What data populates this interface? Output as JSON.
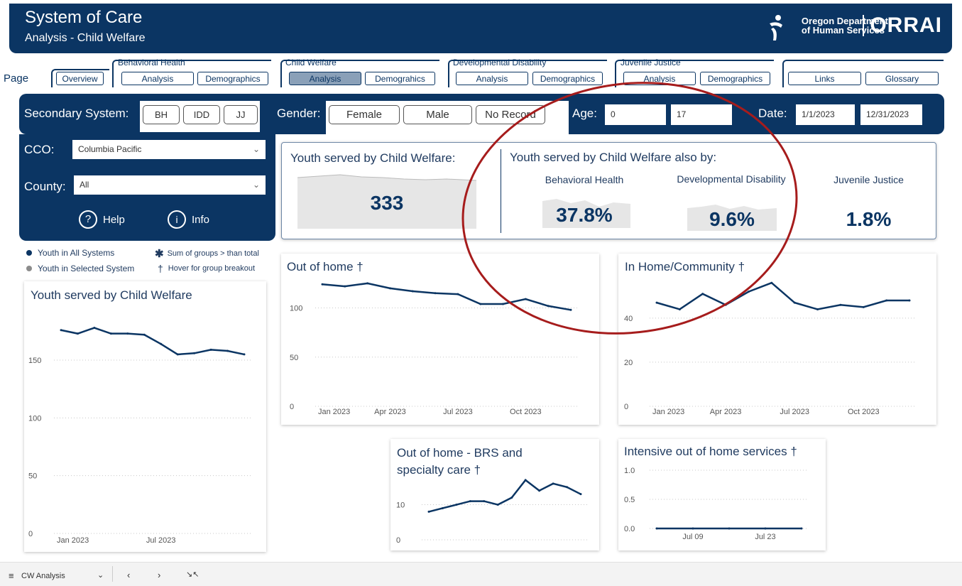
{
  "header": {
    "title": "System of Care",
    "subtitle": "Analysis - Child Welfare",
    "logo_line1": "Oregon Department",
    "logo_line2": "of Human Services",
    "logo_brand": "ORRAI"
  },
  "nav": {
    "page_label": "Page",
    "overview": "Overview",
    "groups": [
      {
        "label": "Behavioral Health",
        "analysis": "Analysis",
        "demo": "Demographics"
      },
      {
        "label": "Child Welfare",
        "analysis": "Analysis",
        "demo": "Demograhics"
      },
      {
        "label": "Developmental Disability",
        "analysis": "Analysis",
        "demo": "Demographics"
      },
      {
        "label": "Juvenile Justice",
        "analysis": "Analysis",
        "demo": "Demographics"
      }
    ],
    "links": "Links",
    "glossary": "Glossary"
  },
  "filters": {
    "secondary_label": "Secondary System:",
    "secondary_options": [
      "BH",
      "IDD",
      "JJ"
    ],
    "gender_label": "Gender:",
    "gender_options": [
      "Female",
      "Male",
      "No Record"
    ],
    "age_label": "Age:",
    "age_min": "0",
    "age_max": "17",
    "date_label": "Date:",
    "date_start": "1/1/2023",
    "date_end": "12/31/2023",
    "cco_label": "CCO:",
    "cco_value": "Columbia Pacific",
    "county_label": "County:",
    "county_value": "All",
    "help": "Help",
    "info": "Info"
  },
  "kpi": {
    "served_label": "Youth served by Child Welfare:",
    "served_value": "333",
    "also_label": "Youth served by Child Welfare also by:",
    "bh_label": "Behavioral Health",
    "bh_value": "37.8%",
    "dd_label": "Developmental Disability",
    "dd_value": "9.6%",
    "jj_label": "Juvenile Justice",
    "jj_value": "1.8%"
  },
  "legend": {
    "all": "Youth in All Systems",
    "selected": "Youth in Selected System",
    "sum_note": "Sum of groups > than total",
    "hover_note": "Hover for group breakout"
  },
  "colors": {
    "navy": "#0b3563",
    "annotation_circle": "#a61c1c",
    "legend_gray": "#8c8c8c"
  },
  "chart_data": [
    {
      "id": "served",
      "type": "line",
      "title": "Youth served by Child Welfare",
      "x": [
        "Jan 2023",
        "Feb 2023",
        "Mar 2023",
        "Apr 2023",
        "May 2023",
        "Jun 2023",
        "Jul 2023",
        "Aug 2023",
        "Sep 2023",
        "Oct 2023",
        "Nov 2023",
        "Dec 2023"
      ],
      "x_tick_labels": [
        "Jan 2023",
        "Jul 2023"
      ],
      "values": [
        176,
        173,
        178,
        173,
        173,
        172,
        164,
        155,
        156,
        159,
        158,
        155
      ],
      "yticks": [
        0,
        50,
        100,
        150
      ],
      "ylim": [
        0,
        190
      ]
    },
    {
      "id": "out_of_home",
      "type": "line",
      "title": "Out of home †",
      "x": [
        "Jan 2023",
        "Feb 2023",
        "Mar 2023",
        "Apr 2023",
        "May 2023",
        "Jun 2023",
        "Jul 2023",
        "Aug 2023",
        "Sep 2023",
        "Oct 2023",
        "Nov 2023",
        "Dec 2023"
      ],
      "x_tick_labels": [
        "Jan 2023",
        "Apr 2023",
        "Jul 2023",
        "Oct 2023"
      ],
      "values": [
        124,
        122,
        125,
        120,
        117,
        115,
        114,
        104,
        104,
        109,
        102,
        98
      ],
      "yticks": [
        0,
        50,
        100
      ],
      "ylim": [
        0,
        130
      ]
    },
    {
      "id": "in_home",
      "type": "line",
      "title": "In Home/Community †",
      "x": [
        "Jan 2023",
        "Feb 2023",
        "Mar 2023",
        "Apr 2023",
        "May 2023",
        "Jun 2023",
        "Jul 2023",
        "Aug 2023",
        "Sep 2023",
        "Oct 2023",
        "Nov 2023",
        "Dec 2023"
      ],
      "x_tick_labels": [
        "Jan 2023",
        "Apr 2023",
        "Jul 2023",
        "Oct 2023"
      ],
      "values": [
        47,
        44,
        51,
        46,
        52,
        56,
        47,
        44,
        46,
        45,
        48,
        48
      ],
      "yticks": [
        0,
        20,
        40
      ],
      "ylim": [
        0,
        58
      ]
    },
    {
      "id": "brs",
      "type": "line",
      "title": "Out of home - BRS and specialty care †",
      "x": [
        "Jan 2023",
        "Feb 2023",
        "Mar 2023",
        "Apr 2023",
        "May 2023",
        "Jun 2023",
        "Jul 2023",
        "Aug 2023",
        "Sep 2023",
        "Oct 2023",
        "Nov 2023",
        "Dec 2023"
      ],
      "x_tick_labels": [],
      "values": [
        8,
        9,
        10,
        11,
        11,
        10,
        12,
        17,
        14,
        16,
        15,
        13
      ],
      "yticks": [
        0,
        10
      ],
      "ylim": [
        0,
        19
      ]
    },
    {
      "id": "intensive",
      "type": "line",
      "title": "Intensive out of home services †",
      "x": [
        "Jul 02",
        "Jul 09",
        "Jul 16",
        "Jul 23",
        "Jul 30"
      ],
      "x_tick_labels": [
        "Jul 09",
        "Jul 23"
      ],
      "values": [
        0,
        0,
        0,
        0,
        0
      ],
      "yticks": [
        0.0,
        0.5,
        1.0
      ],
      "ylim": [
        0,
        1.0
      ]
    }
  ],
  "footer": {
    "page_name": "CW Analysis"
  }
}
